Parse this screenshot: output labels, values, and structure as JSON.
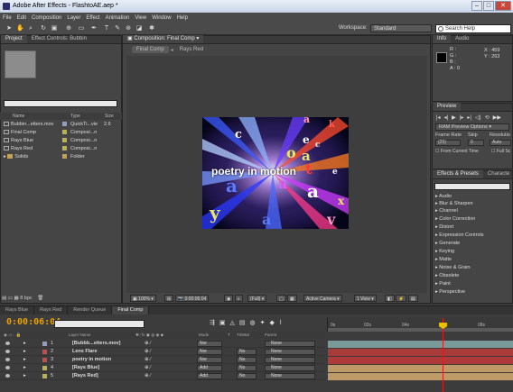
{
  "window": {
    "title": "Adobe After Effects - FlashtoAE.aep *",
    "buttons": [
      "–",
      "□",
      "✕"
    ]
  },
  "menu": [
    "File",
    "Edit",
    "Composition",
    "Layer",
    "Effect",
    "Animation",
    "View",
    "Window",
    "Help"
  ],
  "toolbar": {
    "workspace_label": "Workspace:",
    "workspace_value": "Standard",
    "search_placeholder": "Search Help"
  },
  "project_panel": {
    "tabs": [
      "Project",
      "Effect Controls: Bubbin"
    ],
    "columns": {
      "name": "Name",
      "type": "Type",
      "size": "Size"
    },
    "items": [
      {
        "name": "Bubbin...etters.mov",
        "type": "QuickTi...vie",
        "size": "2.6",
        "label_color": "#8e9ec2"
      },
      {
        "name": "Final Comp",
        "type": "Composi...n",
        "size": "",
        "label_color": "#b8b24a"
      },
      {
        "name": "Rays Blue",
        "type": "Composi...n",
        "size": "",
        "label_color": "#b8b24a"
      },
      {
        "name": "Rays Red",
        "type": "Composi...n",
        "size": "",
        "label_color": "#b8b24a"
      },
      {
        "name": "Solids",
        "type": "Folder",
        "size": "",
        "label_color": "#c7a24e"
      }
    ],
    "bit_depth": "8 bpc"
  },
  "composition_panel": {
    "tab": "Composition: Final Comp",
    "breadcrumbs": [
      "Final Comp",
      "Rays Red"
    ],
    "canvas_text": "poetry in motion",
    "zoom": "100%",
    "timecode": "0:00:06:04",
    "resolution": "(Full)",
    "camera": "Active Camera",
    "views": "1 View"
  },
  "info_panel": {
    "tabs": [
      "Info",
      "Audio"
    ],
    "r": "R :",
    "g": "G :",
    "b": "B :",
    "a": "A : 0",
    "x": "X : 459",
    "y": "Y : 263"
  },
  "preview_panel": {
    "tab": "Preview",
    "options": "RAM Preview Options",
    "frame_rate_label": "Frame Rate",
    "skip_label": "Skip",
    "resolution_label": "Resolutio",
    "frame_rate": "(25)",
    "skip": "0",
    "resolution": "Auto",
    "from_current": "From Current Time",
    "full_screen": "Full Sc"
  },
  "effects_panel": {
    "tabs": [
      "Effects & Presets",
      "Characte"
    ],
    "categories": [
      "Audio",
      "Blur & Sharpen",
      "Channel",
      "Color Correction",
      "Distort",
      "Expression Controls",
      "Generate",
      "Keying",
      "Matte",
      "Noise & Grain",
      "Obsolete",
      "Paint",
      "Perspective"
    ]
  },
  "timeline": {
    "tabs": [
      "Rays Blue",
      "Rays Red",
      "Render Queue",
      "Final Comp"
    ],
    "current_time": "0:00:06:04",
    "columns": {
      "layer_name": "Layer Name",
      "mode": "Mode",
      "t": "T",
      "trkmat": "TrkMat",
      "parent": "Parent"
    },
    "ruler_labels": [
      "0s",
      "02s",
      "04s",
      "06s",
      "08s"
    ],
    "playhead_time": "06s",
    "layers": [
      {
        "num": "1",
        "name": "[Bubbb...etters.mov]",
        "mode": "Nor",
        "trkmat": "",
        "parent": "None",
        "label_color": "#8e9ec2",
        "bar_color": "#7a9a9a"
      },
      {
        "num": "2",
        "name": "Lens Flare",
        "mode": "Nor",
        "trkmat": "No",
        "parent": "None",
        "label_color": "#c94a4a",
        "bar_color": "#a83a3a"
      },
      {
        "num": "3",
        "name": "poetry in motion",
        "mode": "Nor",
        "trkmat": "No",
        "parent": "None",
        "label_color": "#c94a4a",
        "bar_color": "#b03a3a"
      },
      {
        "num": "4",
        "name": "[Rays Blue]",
        "mode": "Add",
        "trkmat": "No",
        "parent": "None",
        "label_color": "#b8b24a",
        "bar_color": "#bd9a66"
      },
      {
        "num": "5",
        "name": "[Rays Red]",
        "mode": "Add",
        "trkmat": "No",
        "parent": "None",
        "label_color": "#b8b24a",
        "bar_color": "#bd9a66"
      }
    ]
  },
  "colors": {
    "timecode": "#e8a000",
    "playhead": "#d62020",
    "panel_bg": "#454545"
  }
}
